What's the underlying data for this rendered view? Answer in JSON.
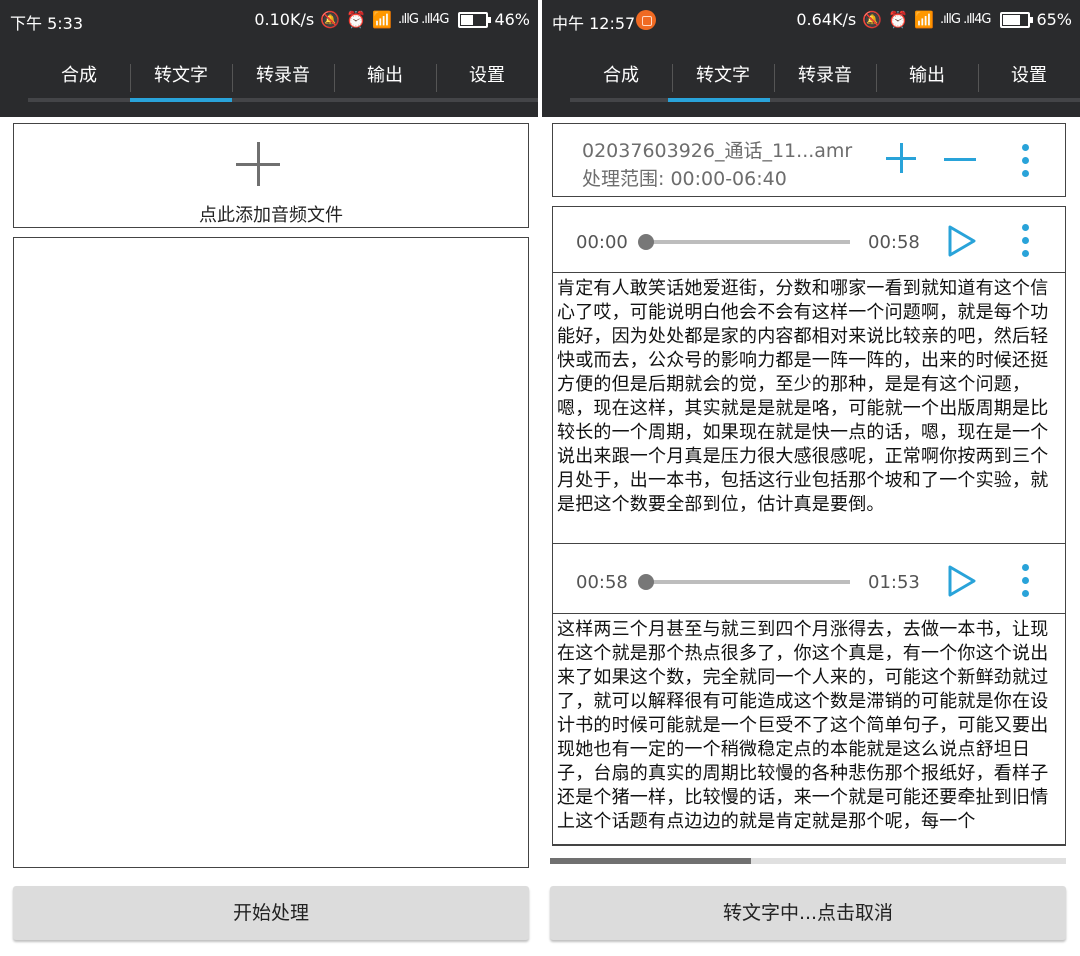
{
  "left": {
    "status": {
      "time": "下午 5:33",
      "speed": "0.10K/s",
      "signal": ".ıllG .ıll4G",
      "battery": "46%",
      "battery_level": 0.46
    },
    "tabs": [
      "合成",
      "转文字",
      "转录音",
      "输出",
      "设置"
    ],
    "active_tab": "转文字",
    "add_file_label": "点此添加音频文件",
    "start_button": "开始处理"
  },
  "right": {
    "status": {
      "time": "中午 12:57",
      "speed": "0.64K/s",
      "signal": ".ıllG .ıll4G",
      "battery": "65%",
      "battery_level": 0.65
    },
    "tabs": [
      "合成",
      "转文字",
      "转录音",
      "输出",
      "设置"
    ],
    "active_tab": "转文字",
    "file": {
      "name": "02037603926_通话_11...amr",
      "range": "处理范围: 00:00-06:40"
    },
    "segments": [
      {
        "start": "00:00",
        "end": "00:58",
        "text": "肯定有人敢笑话她爱逛街，分数和哪家一看到就知道有这个信心了哎，可能说明白他会不会有这样一个问题啊，就是每个功能好，因为处处都是家的内容都相对来说比较亲的吧，然后轻快或而去，公众号的影响力都是一阵一阵的，出来的时候还挺方便的但是后期就会的觉，至少的那种，是是有这个问题，嗯，现在这样，其实就是是就是咯，可能就一个出版周期是比较长的一个周期，如果现在就是快一点的话，嗯，现在是一个说出来跟一个月真是压力很大感很感呢，正常啊你按两到三个月处于，出一本书，包括这行业包括那个坡和了一个实验，就是把这个数要全部到位，估计真是要倒。"
      },
      {
        "start": "00:58",
        "end": "01:53",
        "text": "这样两三个月甚至与就三到四个月涨得去，去做一本书，让现在这个就是那个热点很多了，你这个真是，有一个你这个说出来了如果这个数，完全就同一个人来的，可能这个新鲜劲就过了，就可以解释很有可能造成这个数是滞销的可能就是你在设计书的时候可能就是一个巨受不了这个简单句子，可能又要出现她也有一定的一个稍微稳定点的本能就是这么说点舒坦日子，台扇的真实的周期比较慢的各种悲伤那个报纸好，看样子还是个猪一样，比较慢的话，来一个就是可能还要牵扯到旧情上这个话题有点边边的就是肯定就是那个呢，每一个"
      }
    ],
    "progress": 0.39,
    "cancel_button": "转文字中...点击取消"
  },
  "colors": {
    "header": "#2a2b2d",
    "accent": "#29a3d9",
    "button": "#dcdcdc"
  }
}
